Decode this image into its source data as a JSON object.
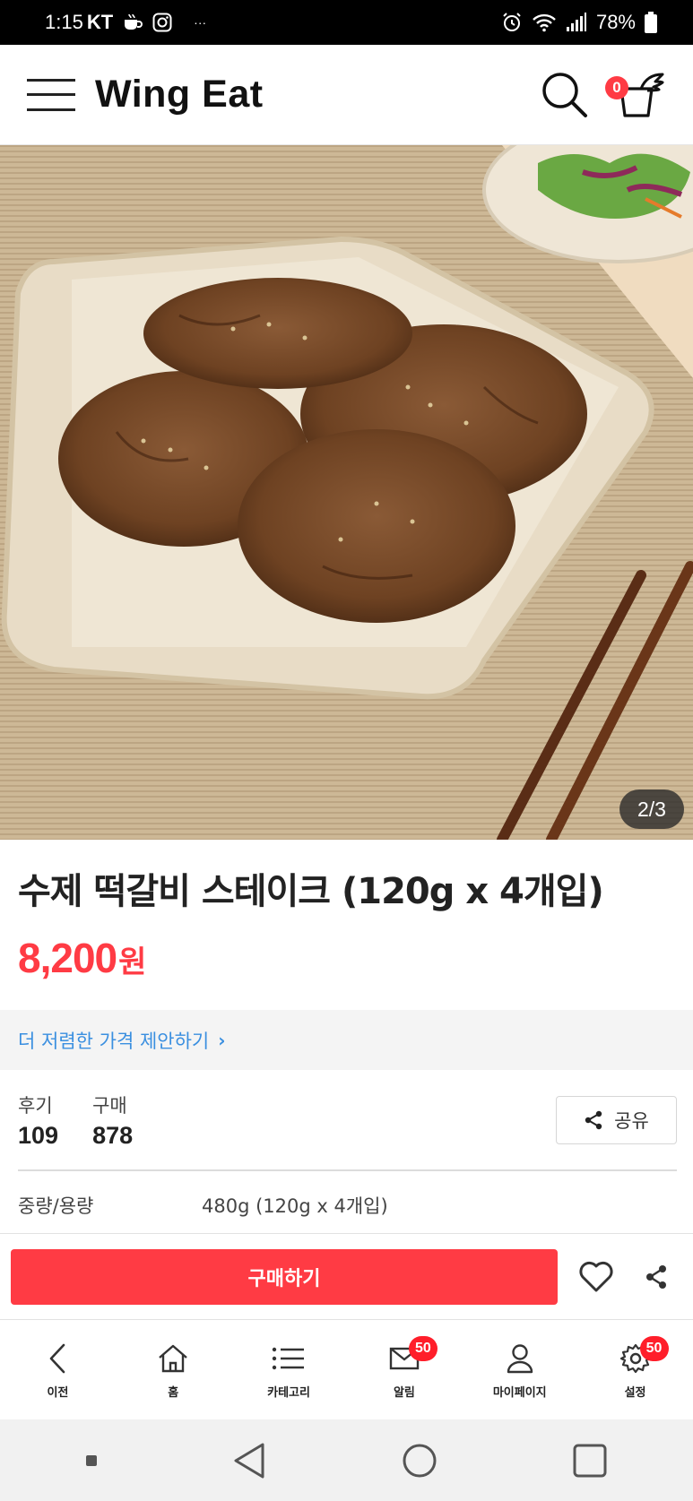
{
  "status_bar": {
    "time": "1:15",
    "carrier": "KT",
    "more": "···",
    "battery": "78%"
  },
  "header": {
    "brand": "Wing Eat",
    "cart_count": "0"
  },
  "product": {
    "image_counter": "2/3",
    "title": "수제 떡갈비 스테이크 (120g x 4개입)",
    "price": "8,200",
    "price_unit": "원",
    "offer_link": "더 저렴한 가격 제안하기",
    "stats": {
      "reviews_label": "후기",
      "reviews_value": "109",
      "purchases_label": "구매",
      "purchases_value": "878"
    },
    "share_label": "공유",
    "spec_label": "중량/용량",
    "spec_value": "480g (120g x 4개입)"
  },
  "purchase_bar": {
    "buy_label": "구매하기"
  },
  "bottom_nav": {
    "items": [
      {
        "label": "이전",
        "icon": "back-icon"
      },
      {
        "label": "홈",
        "icon": "home-icon"
      },
      {
        "label": "카테고리",
        "icon": "list-icon"
      },
      {
        "label": "알림",
        "icon": "mail-icon",
        "badge": "50"
      },
      {
        "label": "마이페이지",
        "icon": "person-icon"
      },
      {
        "label": "설정",
        "icon": "gear-icon",
        "badge": "50"
      }
    ]
  },
  "colors": {
    "accent": "#ff3b44",
    "link": "#3a8fe0"
  }
}
